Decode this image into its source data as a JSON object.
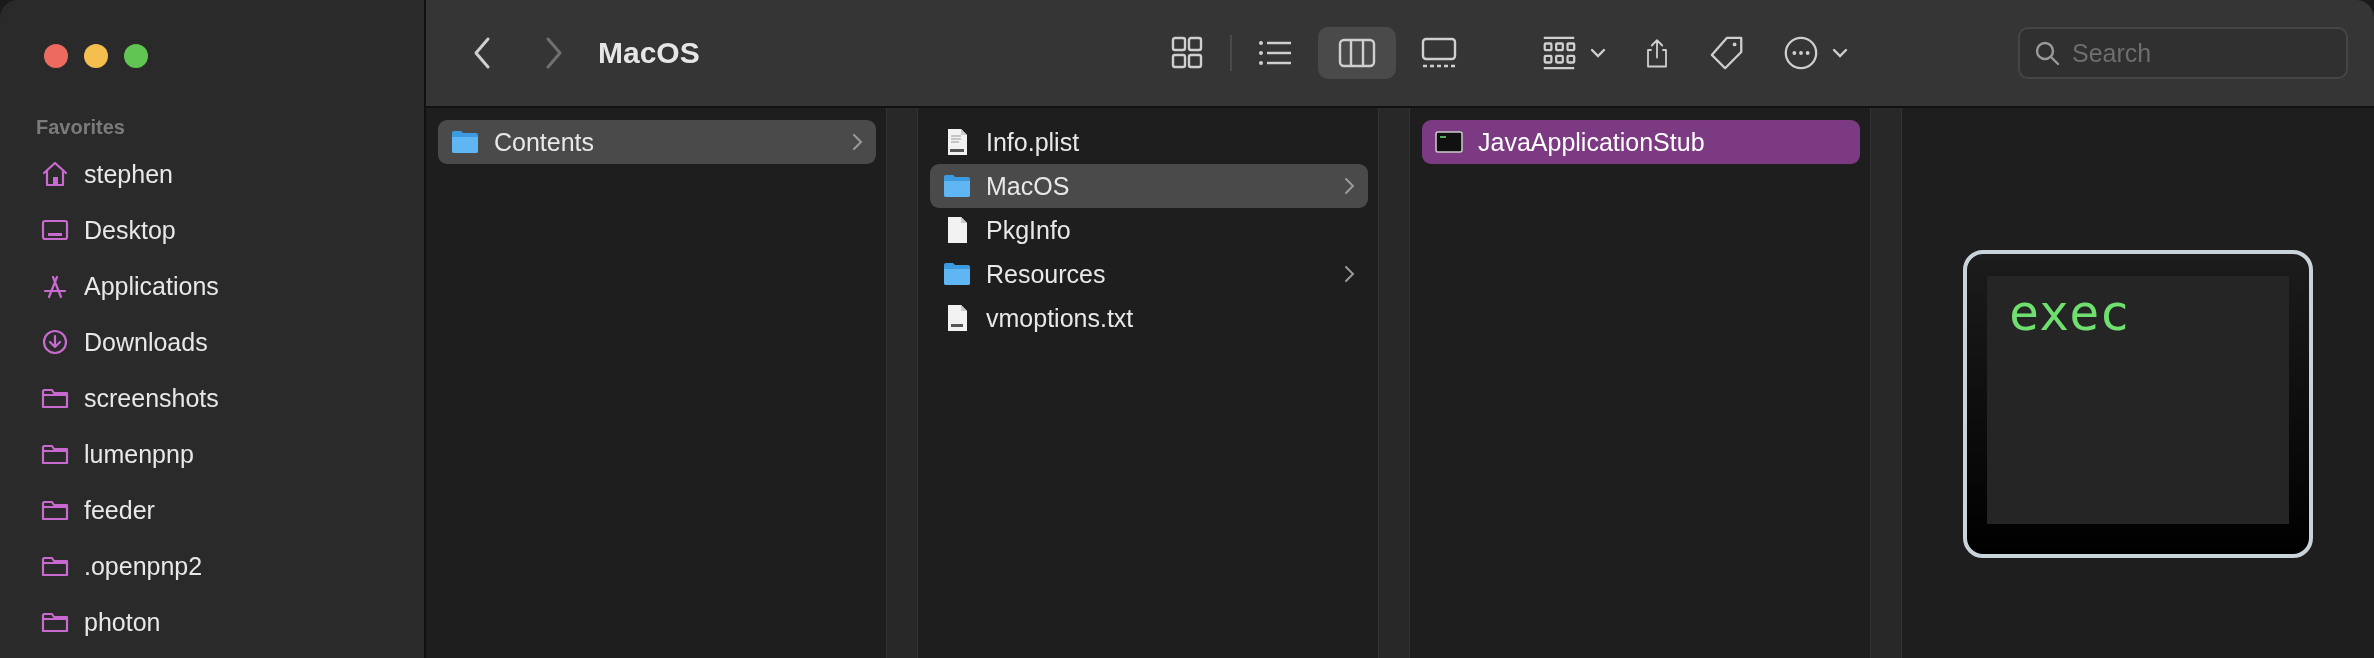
{
  "window": {
    "title": "MacOS"
  },
  "sidebar": {
    "heading": "Favorites",
    "items": [
      {
        "label": "stephen",
        "kind": "home"
      },
      {
        "label": "Desktop",
        "kind": "desktop"
      },
      {
        "label": "Applications",
        "kind": "applications"
      },
      {
        "label": "Downloads",
        "kind": "downloads"
      },
      {
        "label": "screenshots",
        "kind": "folder"
      },
      {
        "label": "lumenpnp",
        "kind": "folder"
      },
      {
        "label": "feeder",
        "kind": "folder"
      },
      {
        "label": ".openpnp2",
        "kind": "folder"
      },
      {
        "label": "photon",
        "kind": "folder"
      }
    ]
  },
  "toolbar": {
    "view_buttons": [
      {
        "kind": "icons",
        "selected": false
      },
      {
        "kind": "list",
        "selected": false
      },
      {
        "kind": "columns",
        "selected": true
      },
      {
        "kind": "gallery",
        "selected": false
      }
    ],
    "search": {
      "placeholder": "Search"
    }
  },
  "columns": [
    {
      "focused": false,
      "items": [
        {
          "name": "Contents",
          "kind": "folder",
          "expandable": true,
          "selected": true
        }
      ]
    },
    {
      "focused": false,
      "items": [
        {
          "name": "Info.plist",
          "kind": "plist",
          "expandable": false,
          "selected": false
        },
        {
          "name": "MacOS",
          "kind": "folder",
          "expandable": true,
          "selected": true
        },
        {
          "name": "PkgInfo",
          "kind": "file",
          "expandable": false,
          "selected": false
        },
        {
          "name": "Resources",
          "kind": "folder",
          "expandable": true,
          "selected": false
        },
        {
          "name": "vmoptions.txt",
          "kind": "txt",
          "expandable": false,
          "selected": false
        }
      ]
    },
    {
      "focused": true,
      "items": [
        {
          "name": "JavaApplicationStub",
          "kind": "exec",
          "expandable": false,
          "selected": true
        }
      ]
    }
  ],
  "preview": {
    "icon_text": "exec"
  }
}
